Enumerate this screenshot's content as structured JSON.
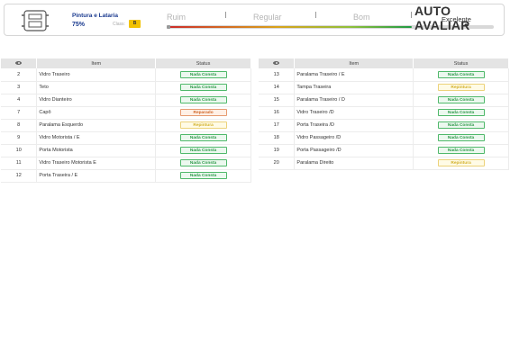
{
  "header": {
    "section_name": "Pintura e Lataria",
    "percent": "75%",
    "class_label": "Class:",
    "class_value": "B",
    "scale": [
      "Ruim",
      "Regular",
      "Bom"
    ],
    "level_text": "Excelente",
    "level_percent": 75,
    "logo": {
      "part1": "AUTO",
      "part2": "AVALIAR"
    }
  },
  "table_header": {
    "item": "Item",
    "status": "Status",
    "eye_icon": "eye-icon"
  },
  "status_labels": {
    "ok": "Nada Consta",
    "rep": "Reparado",
    "pin": "Repintura"
  },
  "left_rows": [
    {
      "num": "2",
      "name": "Vidro Traseiro",
      "status": "Nada Consta",
      "kind": "ok"
    },
    {
      "num": "3",
      "name": "Teto",
      "status": "Nada Consta",
      "kind": "ok"
    },
    {
      "num": "4",
      "name": "Vidro Dianteiro",
      "status": "Nada Consta",
      "kind": "ok"
    },
    {
      "num": "7",
      "name": "Capô",
      "status": "Reparado",
      "kind": "rep"
    },
    {
      "num": "8",
      "name": "Paralama Esquerdo",
      "status": "Repintura",
      "kind": "pin"
    },
    {
      "num": "9",
      "name": "Vidro Motorista / E",
      "status": "Nada Consta",
      "kind": "ok"
    },
    {
      "num": "10",
      "name": "Porta Motorista",
      "status": "Nada Consta",
      "kind": "ok"
    },
    {
      "num": "11",
      "name": "Vidro Traseiro Motorista E",
      "status": "Nada Consta",
      "kind": "ok"
    },
    {
      "num": "12",
      "name": "Porta Traseira / E",
      "status": "Nada Consta",
      "kind": "ok"
    }
  ],
  "right_rows": [
    {
      "num": "13",
      "name": "Paralama Traseiro / E",
      "status": "Nada Consta",
      "kind": "ok"
    },
    {
      "num": "14",
      "name": "Tampa Traseira",
      "status": "Repintura",
      "kind": "pin"
    },
    {
      "num": "15",
      "name": "Paralama Traseiro / D",
      "status": "Nada Consta",
      "kind": "ok"
    },
    {
      "num": "16",
      "name": "Vidro Traseiro /D",
      "status": "Nada Consta",
      "kind": "ok"
    },
    {
      "num": "17",
      "name": "Porta Traseira /D",
      "status": "Nada Consta",
      "kind": "ok"
    },
    {
      "num": "18",
      "name": "Vidro Passageiro /D",
      "status": "Nada Consta",
      "kind": "ok"
    },
    {
      "num": "19",
      "name": "Porta Passageiro /D",
      "status": "Nada Consta",
      "kind": "ok"
    },
    {
      "num": "20",
      "name": "Paralama Direito",
      "status": "Repintura",
      "kind": "pin"
    }
  ]
}
